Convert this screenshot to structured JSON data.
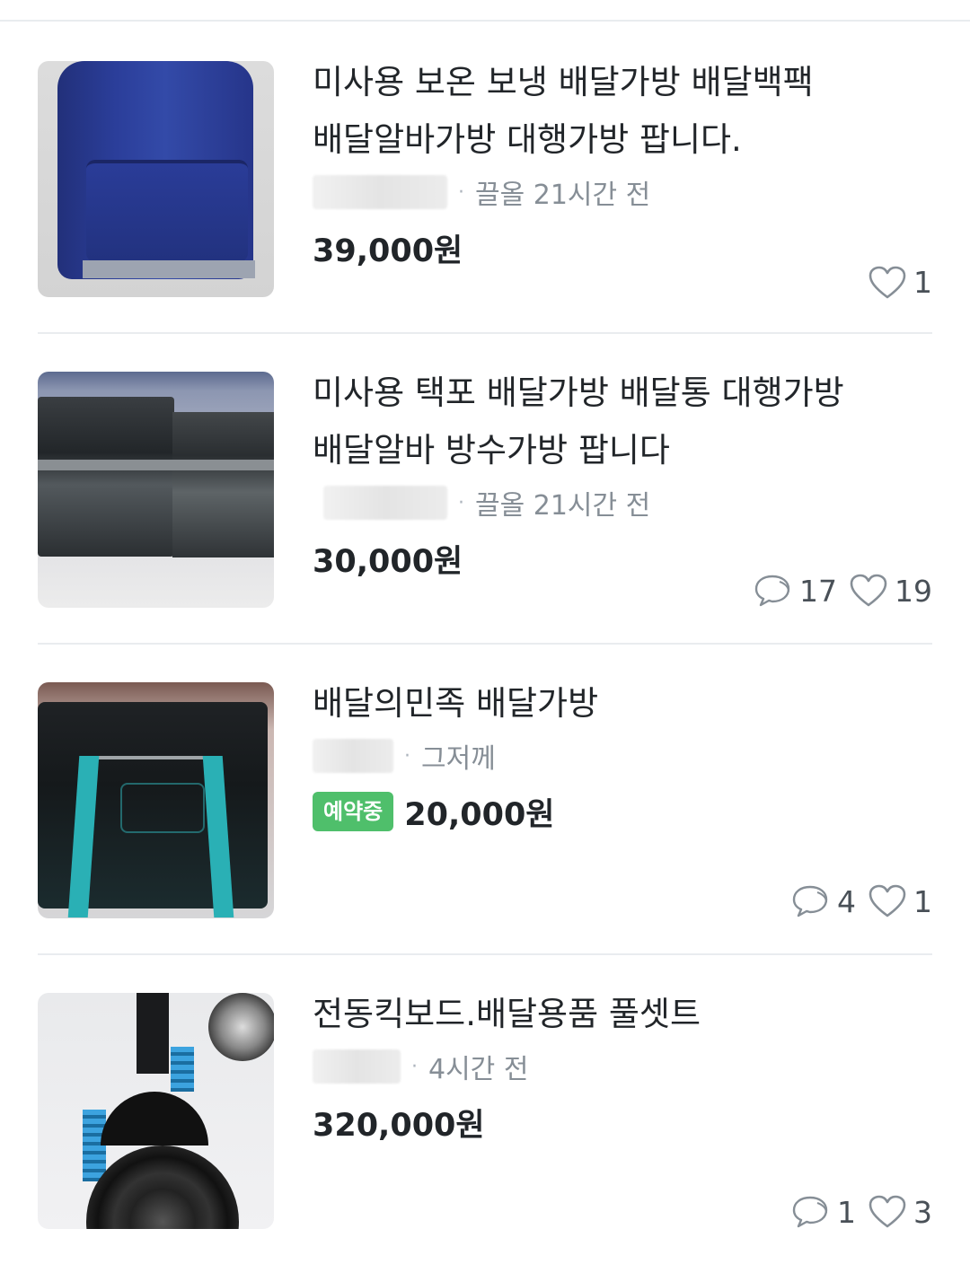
{
  "listings": [
    {
      "title": "미사용 보온 보냉 배달가방 배달백팩 배달알바가방 대행가방 팝니다.",
      "location_time": "끌올 21시간 전",
      "price": "39,000원",
      "status_badge": "",
      "chats": "",
      "likes": "1"
    },
    {
      "title": "미사용 택포 배달가방 배달통 대행가방 배달알바 방수가방 팝니다",
      "location_time": "끌올 21시간 전",
      "price": "30,000원",
      "status_badge": "",
      "chats": "17",
      "likes": "19"
    },
    {
      "title": "배달의민족 배달가방",
      "location_time": "그저께",
      "price": "20,000원",
      "status_badge": "예약중",
      "chats": "4",
      "likes": "1"
    },
    {
      "title": "전동킥보드.배달용품 풀셋트",
      "location_time": "4시간 전",
      "price": "320,000원",
      "status_badge": "",
      "chats": "1",
      "likes": "3"
    }
  ],
  "colors": {
    "badge": "#4fbf6b",
    "divider": "#e9ecef",
    "muted_text": "#868e96"
  },
  "icons": [
    "chat-bubble-icon",
    "heart-icon"
  ]
}
